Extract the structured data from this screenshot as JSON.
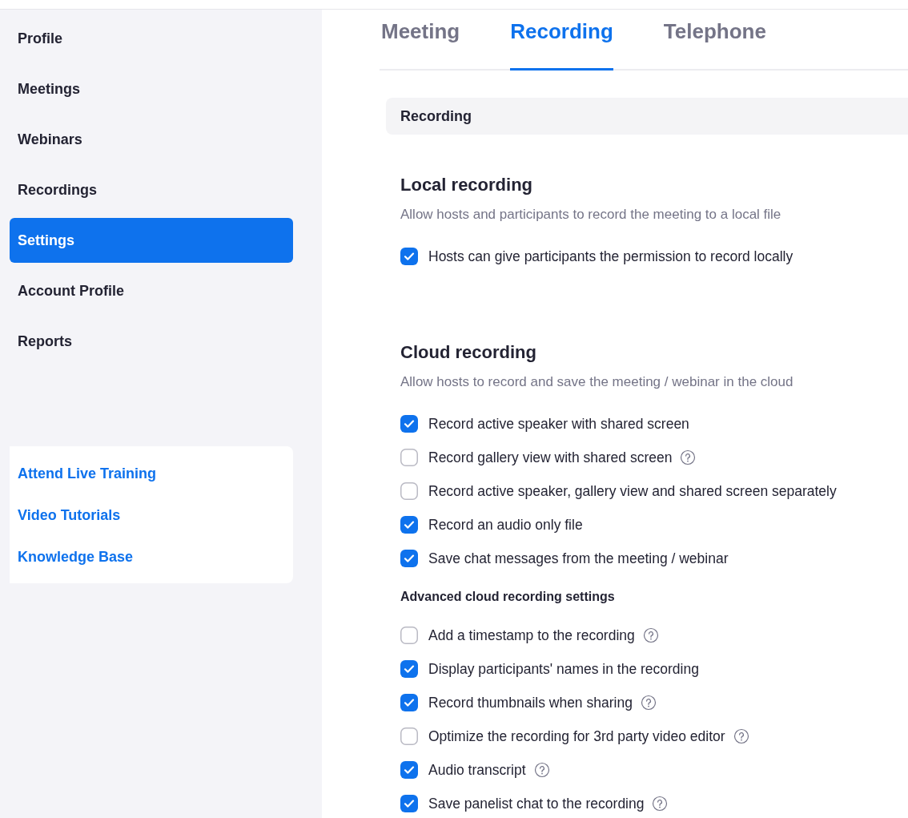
{
  "sidebar": {
    "items": [
      {
        "label": "Profile",
        "selected": false
      },
      {
        "label": "Meetings",
        "selected": false
      },
      {
        "label": "Webinars",
        "selected": false
      },
      {
        "label": "Recordings",
        "selected": false
      },
      {
        "label": "Settings",
        "selected": true
      },
      {
        "label": "Account Profile",
        "selected": false
      },
      {
        "label": "Reports",
        "selected": false
      }
    ],
    "help_links": [
      "Attend Live Training",
      "Video Tutorials",
      "Knowledge Base"
    ]
  },
  "tabs": [
    {
      "label": "Meeting",
      "selected": false
    },
    {
      "label": "Recording",
      "selected": true
    },
    {
      "label": "Telephone",
      "selected": false
    }
  ],
  "section_header": "Recording",
  "sections": [
    {
      "title": "Local recording",
      "description": "Allow hosts and participants to record the meeting to a local file",
      "items": [
        {
          "kind": "option",
          "label": "Hosts can give participants the permission to record locally",
          "checked": true,
          "help": false
        }
      ]
    },
    {
      "title": "Cloud recording",
      "description": "Allow hosts to record and save the meeting / webinar in the cloud",
      "items": [
        {
          "kind": "option",
          "label": "Record active speaker with shared screen",
          "checked": true,
          "help": false
        },
        {
          "kind": "option",
          "label": "Record gallery view with shared screen",
          "checked": false,
          "help": true
        },
        {
          "kind": "option",
          "label": "Record active speaker, gallery view and shared screen separately",
          "checked": false,
          "help": false
        },
        {
          "kind": "option",
          "label": "Record an audio only file",
          "checked": true,
          "help": false
        },
        {
          "kind": "option",
          "label": "Save chat messages from the meeting / webinar",
          "checked": true,
          "help": false
        },
        {
          "kind": "subheading",
          "label": "Advanced cloud recording settings"
        },
        {
          "kind": "option",
          "label": "Add a timestamp to the recording",
          "checked": false,
          "help": true
        },
        {
          "kind": "option",
          "label": "Display participants' names in the recording",
          "checked": true,
          "help": false
        },
        {
          "kind": "option",
          "label": "Record thumbnails when sharing",
          "checked": true,
          "help": true
        },
        {
          "kind": "option",
          "label": "Optimize the recording for 3rd party video editor",
          "checked": false,
          "help": true
        },
        {
          "kind": "option",
          "label": "Audio transcript",
          "checked": true,
          "help": true
        },
        {
          "kind": "option",
          "label": "Save panelist chat to the recording",
          "checked": true,
          "help": true
        }
      ]
    }
  ]
}
